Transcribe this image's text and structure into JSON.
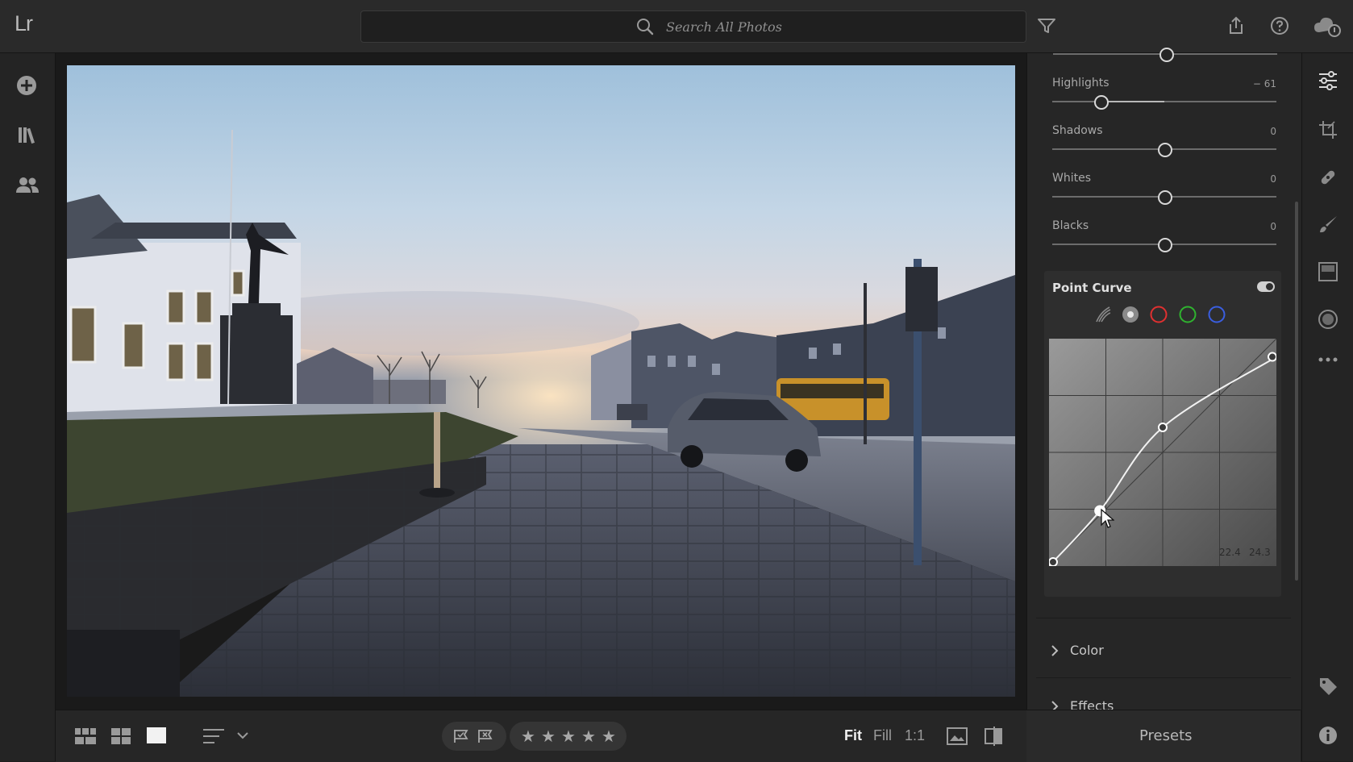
{
  "app": {
    "logo": "Lr"
  },
  "topbar": {
    "search_placeholder": "Search All Photos",
    "icons": [
      "search-icon",
      "filter-icon",
      "share-icon",
      "help-icon",
      "cloud-sync-icon"
    ]
  },
  "leftrail": {
    "icons": [
      "add-photos-icon",
      "library-icon",
      "people-icon"
    ]
  },
  "bottombar": {
    "view_icons": [
      "square-grid-view-icon",
      "grid-view-icon",
      "detail-view-icon"
    ],
    "sort_icon": "sort-icon",
    "flag_icons": [
      "pick-flag-icon",
      "reject-flag-icon"
    ],
    "stars": [
      "★",
      "★",
      "★",
      "★",
      "★"
    ],
    "zoom": {
      "fit": "Fit",
      "fill": "Fill",
      "one_to_one": "1:1"
    }
  },
  "light_panel": {
    "sliders": [
      {
        "label": "Highlights",
        "value": "− 61",
        "position": 0.195
      },
      {
        "label": "Shadows",
        "value": "0",
        "position": 0.5
      },
      {
        "label": "Whites",
        "value": "0",
        "position": 0.5
      },
      {
        "label": "Blacks",
        "value": "0",
        "position": 0.5
      }
    ]
  },
  "point_curve": {
    "title": "Point Curve",
    "enabled": true,
    "channels": [
      "parametric",
      "rgb",
      "red",
      "green",
      "blue"
    ],
    "channel_colors": {
      "red": "#e03030",
      "green": "#2fb32f",
      "blue": "#3a5ee0"
    },
    "readout": {
      "input": "22.4",
      "output": "24.3"
    },
    "points": [
      [
        0,
        0
      ],
      [
        22.4,
        24.3
      ],
      [
        50,
        61
      ],
      [
        100,
        92
      ]
    ]
  },
  "sections": {
    "color": "Color",
    "effects": "Effects"
  },
  "presets": {
    "label": "Presets"
  },
  "rightrail": {
    "icons": [
      "edit-sliders-icon",
      "crop-icon",
      "healing-icon",
      "brush-icon",
      "linear-gradient-icon",
      "radial-gradient-icon",
      "more-icon",
      "tag-icon",
      "info-icon"
    ]
  }
}
